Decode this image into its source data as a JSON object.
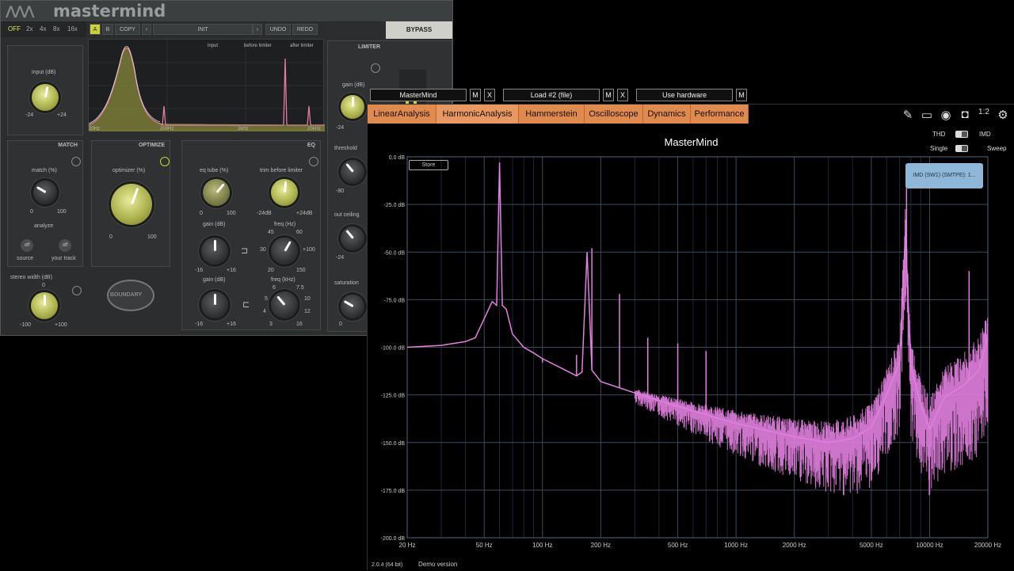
{
  "plugin": {
    "logo": "mastermind",
    "oversampling": [
      "OFF",
      "2x",
      "4x",
      "8x",
      "16x"
    ],
    "preset": {
      "a": "A",
      "b": "B",
      "copy": "COPY",
      "name": "INIT",
      "undo": "UNDO",
      "redo": "REDO"
    },
    "bypass": "BYPASS",
    "spectrum_legend": [
      "input",
      "before limiter",
      "after limiter"
    ],
    "spectrum_ticks": [
      "20Hz",
      "200Hz",
      "2kHz",
      "20kHz"
    ],
    "input": {
      "label": "input (dB)",
      "min": "-24",
      "max": "+24"
    },
    "match": {
      "title": "MATCH",
      "label": "match (%)",
      "min": "0",
      "max": "100",
      "analyze": "analyze",
      "source_btn": "off",
      "source": "source",
      "track_btn": "off",
      "track": "your track"
    },
    "stereo": {
      "label": "stereo width (dB)",
      "mid": "0",
      "min": "-100",
      "max": "+100"
    },
    "optimize": {
      "title": "OPTIMIZE",
      "label": "optimizer (%)",
      "min": "0",
      "max": "100",
      "badge": "BOUNDARY"
    },
    "eq": {
      "title": "EQ",
      "tube_label": "eq tube (%)",
      "tube_min": "0",
      "tube_max": "100",
      "trim_label": "trim before limiter",
      "trim_min": "-24dB",
      "trim_max": "+24dB",
      "gain1": "gain (dB)",
      "g1min": "-16",
      "g1max": "+16",
      "freq_hz": "freq (Hz)",
      "fh": [
        "45",
        "60",
        "30",
        "+100",
        "20",
        "150"
      ],
      "gain2": "gain (dB)",
      "g2min": "-16",
      "g2max": "+16",
      "freq_khz": "freq (kHz)",
      "fk": [
        "6",
        "7.5",
        "5",
        "10",
        "4",
        "12",
        "3",
        "16"
      ]
    },
    "limiter": {
      "title": "LIMITER",
      "gain": "gain (dB)",
      "gain_min": "-24",
      "threshold": "threshold",
      "th_min": "-80",
      "out": "out ceiling",
      "out_min": "-24",
      "sat": "saturation",
      "sat_min": "0"
    }
  },
  "toolbar": [
    {
      "label": "MasterMind",
      "m": "M",
      "x": "X"
    },
    {
      "label": "Load #2 (file)",
      "m": "M",
      "x": "X"
    },
    {
      "label": "Use hardware",
      "m": "M"
    }
  ],
  "tabs": [
    "LinearAnalysis",
    "HarmonicAnalysis",
    "Hammerstein",
    "Oscilloscope",
    "Dynamics",
    "Performance"
  ],
  "analyzer": {
    "title": "MasterMind",
    "thd": "THD",
    "imd": "IMD",
    "single": "Single",
    "sweep": "Sweep",
    "store": "Store",
    "imd_box": "IMD (SW1) (SMTPE): 1...",
    "version": "2.0.4 (64 bit)",
    "demo": "Demo version",
    "icons": [
      "notes-icon",
      "book-icon",
      "eye-icon",
      "camera-icon",
      "scale-icon",
      "gear-icon"
    ],
    "trace_color": "#e27fe0"
  },
  "chart_data": {
    "type": "line",
    "title": "MasterMind",
    "xscale": "log",
    "xlim": [
      20,
      20000
    ],
    "ylim": [
      -200,
      0
    ],
    "x_ticks": [
      "20 Hz",
      "50 Hz",
      "100 Hz",
      "200 Hz",
      "500 Hz",
      "1000 Hz",
      "2000 Hz",
      "5000 Hz",
      "10000 Hz",
      "20000 Hz"
    ],
    "y_ticks": [
      "0.0 dB",
      "-25.0 dB",
      "-50.0 dB",
      "-75.0 dB",
      "-100.0 dB",
      "-125.0 dB",
      "-150.0 dB",
      "-175.0 dB",
      "-200.0 dB"
    ],
    "grid": true,
    "series": [
      {
        "x": [
          20,
          30,
          40,
          45,
          50,
          55,
          58,
          60,
          62,
          65,
          70,
          80,
          90,
          100,
          120,
          150,
          160,
          170,
          180,
          190,
          200,
          300,
          500,
          1000,
          2000,
          3000,
          4000,
          5000,
          6000,
          7000,
          7500,
          8000,
          9000,
          10000,
          12000,
          15000,
          18000,
          20000
        ],
        "values": [
          -100,
          -99,
          -97,
          -95,
          -85,
          -76,
          -78,
          -3,
          -78,
          -80,
          -93,
          -100,
          -103,
          -106,
          -110,
          -115,
          -113,
          -50,
          -112,
          -115,
          -118,
          -124,
          -131,
          -140,
          -147,
          -150,
          -148,
          -142,
          -125,
          -108,
          -40,
          -110,
          -130,
          -143,
          -126,
          -120,
          -112,
          -95
        ]
      }
    ],
    "peaks": [
      {
        "x": 100,
        "y": -108
      },
      {
        "x": 150,
        "y": -104
      },
      {
        "x": 180,
        "y": -48
      },
      {
        "x": 250,
        "y": -72
      },
      {
        "x": 350,
        "y": -95
      },
      {
        "x": 500,
        "y": -98
      },
      {
        "x": 700,
        "y": -102
      },
      {
        "x": 7600,
        "y": -12
      },
      {
        "x": 16000,
        "y": -60
      },
      {
        "x": 19500,
        "y": -86
      }
    ]
  }
}
